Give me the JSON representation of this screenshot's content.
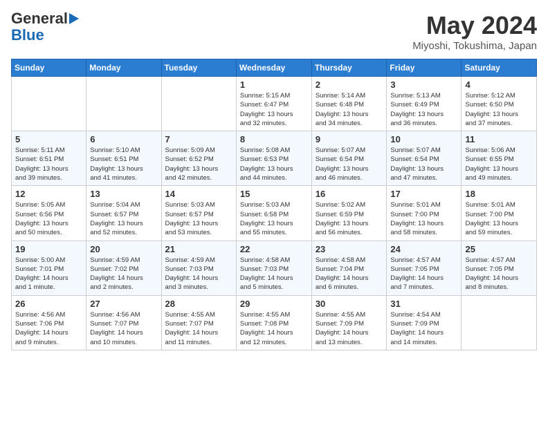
{
  "logo": {
    "line1": "General",
    "line2": "Blue"
  },
  "title": "May 2024",
  "subtitle": "Miyoshi, Tokushima, Japan",
  "weekdays": [
    "Sunday",
    "Monday",
    "Tuesday",
    "Wednesday",
    "Thursday",
    "Friday",
    "Saturday"
  ],
  "weeks": [
    [
      {
        "day": "",
        "info": ""
      },
      {
        "day": "",
        "info": ""
      },
      {
        "day": "",
        "info": ""
      },
      {
        "day": "1",
        "info": "Sunrise: 5:15 AM\nSunset: 6:47 PM\nDaylight: 13 hours\nand 32 minutes."
      },
      {
        "day": "2",
        "info": "Sunrise: 5:14 AM\nSunset: 6:48 PM\nDaylight: 13 hours\nand 34 minutes."
      },
      {
        "day": "3",
        "info": "Sunrise: 5:13 AM\nSunset: 6:49 PM\nDaylight: 13 hours\nand 36 minutes."
      },
      {
        "day": "4",
        "info": "Sunrise: 5:12 AM\nSunset: 6:50 PM\nDaylight: 13 hours\nand 37 minutes."
      }
    ],
    [
      {
        "day": "5",
        "info": "Sunrise: 5:11 AM\nSunset: 6:51 PM\nDaylight: 13 hours\nand 39 minutes."
      },
      {
        "day": "6",
        "info": "Sunrise: 5:10 AM\nSunset: 6:51 PM\nDaylight: 13 hours\nand 41 minutes."
      },
      {
        "day": "7",
        "info": "Sunrise: 5:09 AM\nSunset: 6:52 PM\nDaylight: 13 hours\nand 42 minutes."
      },
      {
        "day": "8",
        "info": "Sunrise: 5:08 AM\nSunset: 6:53 PM\nDaylight: 13 hours\nand 44 minutes."
      },
      {
        "day": "9",
        "info": "Sunrise: 5:07 AM\nSunset: 6:54 PM\nDaylight: 13 hours\nand 46 minutes."
      },
      {
        "day": "10",
        "info": "Sunrise: 5:07 AM\nSunset: 6:54 PM\nDaylight: 13 hours\nand 47 minutes."
      },
      {
        "day": "11",
        "info": "Sunrise: 5:06 AM\nSunset: 6:55 PM\nDaylight: 13 hours\nand 49 minutes."
      }
    ],
    [
      {
        "day": "12",
        "info": "Sunrise: 5:05 AM\nSunset: 6:56 PM\nDaylight: 13 hours\nand 50 minutes."
      },
      {
        "day": "13",
        "info": "Sunrise: 5:04 AM\nSunset: 6:57 PM\nDaylight: 13 hours\nand 52 minutes."
      },
      {
        "day": "14",
        "info": "Sunrise: 5:03 AM\nSunset: 6:57 PM\nDaylight: 13 hours\nand 53 minutes."
      },
      {
        "day": "15",
        "info": "Sunrise: 5:03 AM\nSunset: 6:58 PM\nDaylight: 13 hours\nand 55 minutes."
      },
      {
        "day": "16",
        "info": "Sunrise: 5:02 AM\nSunset: 6:59 PM\nDaylight: 13 hours\nand 56 minutes."
      },
      {
        "day": "17",
        "info": "Sunrise: 5:01 AM\nSunset: 7:00 PM\nDaylight: 13 hours\nand 58 minutes."
      },
      {
        "day": "18",
        "info": "Sunrise: 5:01 AM\nSunset: 7:00 PM\nDaylight: 13 hours\nand 59 minutes."
      }
    ],
    [
      {
        "day": "19",
        "info": "Sunrise: 5:00 AM\nSunset: 7:01 PM\nDaylight: 14 hours\nand 1 minute."
      },
      {
        "day": "20",
        "info": "Sunrise: 4:59 AM\nSunset: 7:02 PM\nDaylight: 14 hours\nand 2 minutes."
      },
      {
        "day": "21",
        "info": "Sunrise: 4:59 AM\nSunset: 7:03 PM\nDaylight: 14 hours\nand 3 minutes."
      },
      {
        "day": "22",
        "info": "Sunrise: 4:58 AM\nSunset: 7:03 PM\nDaylight: 14 hours\nand 5 minutes."
      },
      {
        "day": "23",
        "info": "Sunrise: 4:58 AM\nSunset: 7:04 PM\nDaylight: 14 hours\nand 6 minutes."
      },
      {
        "day": "24",
        "info": "Sunrise: 4:57 AM\nSunset: 7:05 PM\nDaylight: 14 hours\nand 7 minutes."
      },
      {
        "day": "25",
        "info": "Sunrise: 4:57 AM\nSunset: 7:05 PM\nDaylight: 14 hours\nand 8 minutes."
      }
    ],
    [
      {
        "day": "26",
        "info": "Sunrise: 4:56 AM\nSunset: 7:06 PM\nDaylight: 14 hours\nand 9 minutes."
      },
      {
        "day": "27",
        "info": "Sunrise: 4:56 AM\nSunset: 7:07 PM\nDaylight: 14 hours\nand 10 minutes."
      },
      {
        "day": "28",
        "info": "Sunrise: 4:55 AM\nSunset: 7:07 PM\nDaylight: 14 hours\nand 11 minutes."
      },
      {
        "day": "29",
        "info": "Sunrise: 4:55 AM\nSunset: 7:08 PM\nDaylight: 14 hours\nand 12 minutes."
      },
      {
        "day": "30",
        "info": "Sunrise: 4:55 AM\nSunset: 7:09 PM\nDaylight: 14 hours\nand 13 minutes."
      },
      {
        "day": "31",
        "info": "Sunrise: 4:54 AM\nSunset: 7:09 PM\nDaylight: 14 hours\nand 14 minutes."
      },
      {
        "day": "",
        "info": ""
      }
    ]
  ]
}
